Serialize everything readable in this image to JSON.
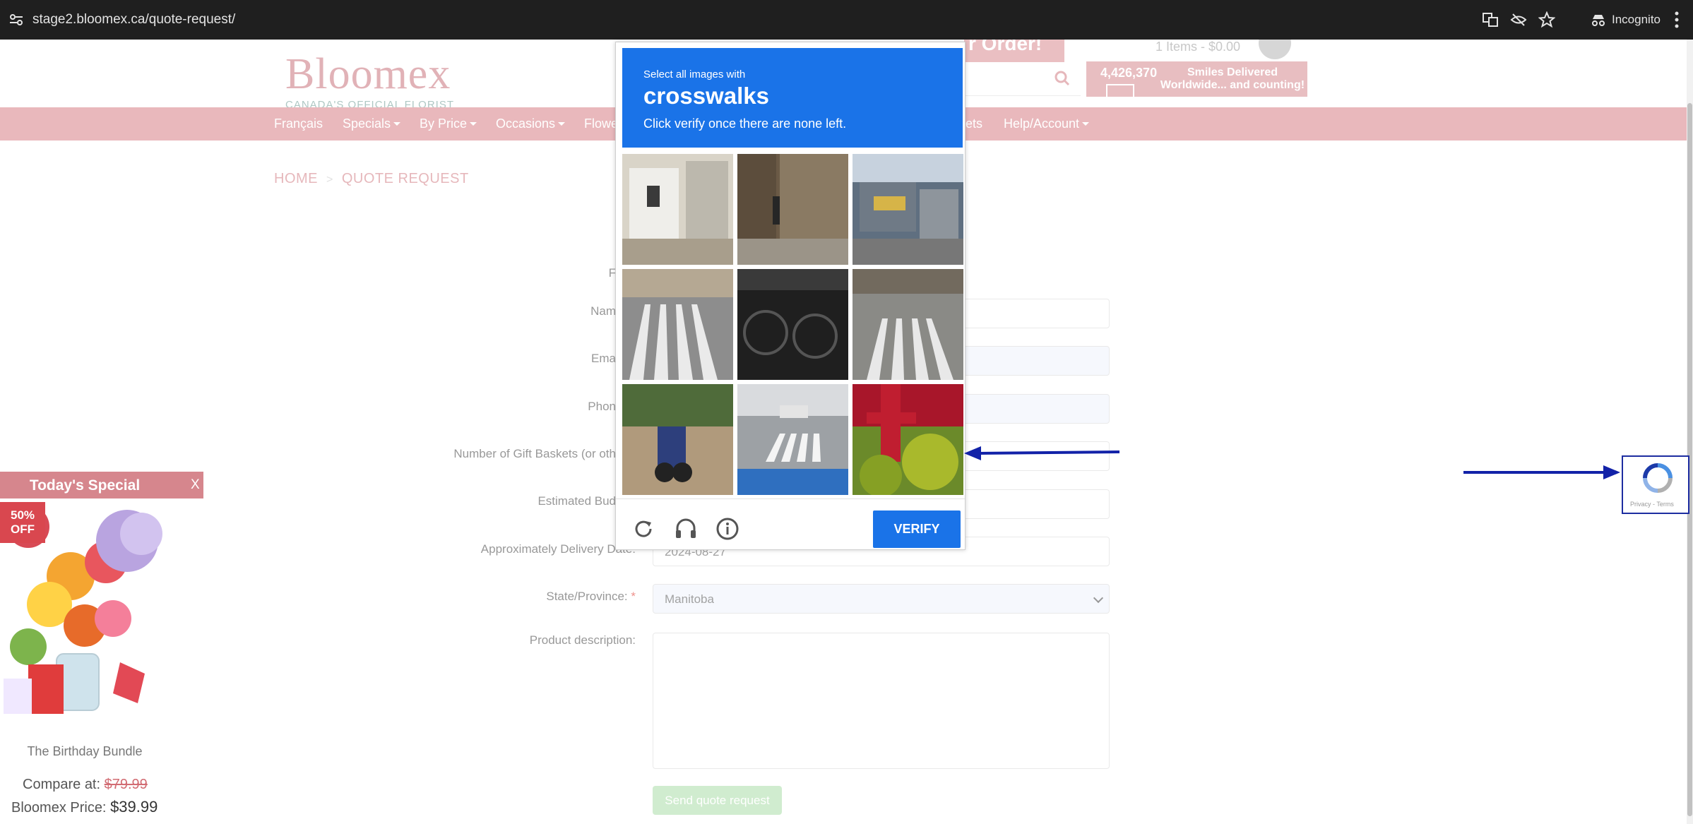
{
  "browser": {
    "url": "stage2.bloomex.ca/quote-request/",
    "incognito_label": "Incognito"
  },
  "header": {
    "logo_text": "Bloomex",
    "logo_tagline": "CANADA'S OFFICIAL FLORIST",
    "cart_text": "1 Items - $0.00",
    "promo_text": "r Order!",
    "smiles_count": "4,426,370",
    "smiles_text": "Smiles Delivered Worldwide... and counting!"
  },
  "nav": {
    "items": [
      "Français",
      "Specials",
      "By Price",
      "Occasions",
      "Flowe",
      "ets",
      "Help/Account"
    ]
  },
  "breadcrumb": {
    "home": "HOME",
    "sep": ">",
    "current": "QUOTE REQUEST"
  },
  "form": {
    "labels": {
      "first": "F",
      "name": "Nam",
      "email": "Ema",
      "phone": "Phon",
      "baskets": "Number of Gift Baskets (or oth",
      "budget": "Estimated Bud",
      "delivery": "Approximately Delivery Date:",
      "state": "State/Province:",
      "description": "Product description:"
    },
    "required_mark": "*",
    "delivery_value": "2024-08-27",
    "state_value": "Manitoba",
    "submit_label": "Send quote request"
  },
  "special": {
    "title": "Today's Special",
    "close": "X",
    "badge": "50% OFF",
    "product_name": "The Birthday Bundle",
    "compare_label": "Compare at:",
    "compare_price": "$79.99",
    "price_label": "Bloomex Price:",
    "price": "$39.99"
  },
  "captcha": {
    "instruction": "Select all images with",
    "target": "crosswalks",
    "sub_instruction": "Click verify once there are none left.",
    "verify_label": "VERIFY",
    "icons": [
      "refresh-icon",
      "headphones-icon",
      "info-icon"
    ]
  },
  "recaptcha": {
    "legal": "Privacy - Terms"
  },
  "colors": {
    "brand_pink": "#d87f85",
    "captcha_blue": "#1a73e8",
    "arrow_blue": "#1222a8"
  }
}
